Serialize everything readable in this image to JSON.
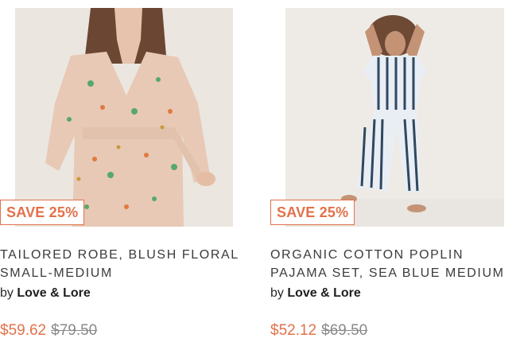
{
  "products": [
    {
      "badge": "SAVE 25%",
      "title_line1": "TAILORED ROBE, BLUSH FLORAL",
      "title_line2": "SMALL-MEDIUM",
      "by_prefix": "by",
      "brand": "Love & Lore",
      "price_now": "$59.62",
      "price_was": "$79.50"
    },
    {
      "badge": "SAVE 25%",
      "title_line1": "ORGANIC COTTON POPLIN",
      "title_line2": "PAJAMA SET, SEA BLUE MEDIUM",
      "by_prefix": "by",
      "brand": "Love & Lore",
      "price_now": "$52.12",
      "price_was": "$69.50"
    }
  ],
  "colors": {
    "accent": "#e2714a",
    "text": "#3b3b3b",
    "muted": "#8a8a8a"
  }
}
